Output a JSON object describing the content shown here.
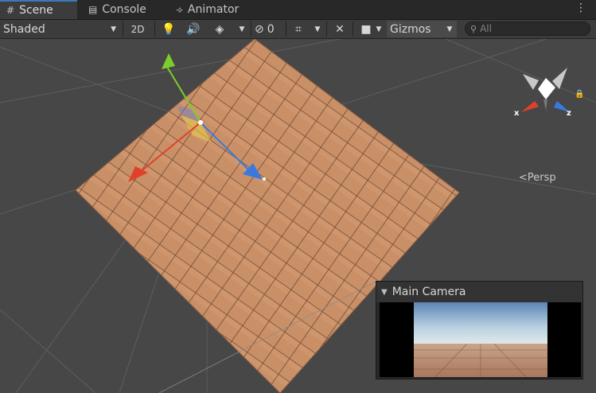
{
  "tabs": [
    {
      "label": "Scene",
      "icon": "grid-icon",
      "active": true
    },
    {
      "label": "Console",
      "icon": "console-icon",
      "active": false
    },
    {
      "label": "Animator",
      "icon": "animator-icon",
      "active": false
    }
  ],
  "toolbar": {
    "shading_mode": "Shaded",
    "mode_2d": "2D",
    "hidden_count": "0",
    "gizmos_label": "Gizmos",
    "search_placeholder": "All"
  },
  "viewport": {
    "projection_label": "Persp",
    "axis_x": "x",
    "axis_z": "z"
  },
  "camera_preview": {
    "title": "Main Camera"
  },
  "colors": {
    "accent": "#3a79bb",
    "background": "#474747",
    "plane": "#c98f66",
    "gizmo_x": "#e0412a",
    "gizmo_y": "#7bcf2a",
    "gizmo_z": "#3a7ae0"
  }
}
